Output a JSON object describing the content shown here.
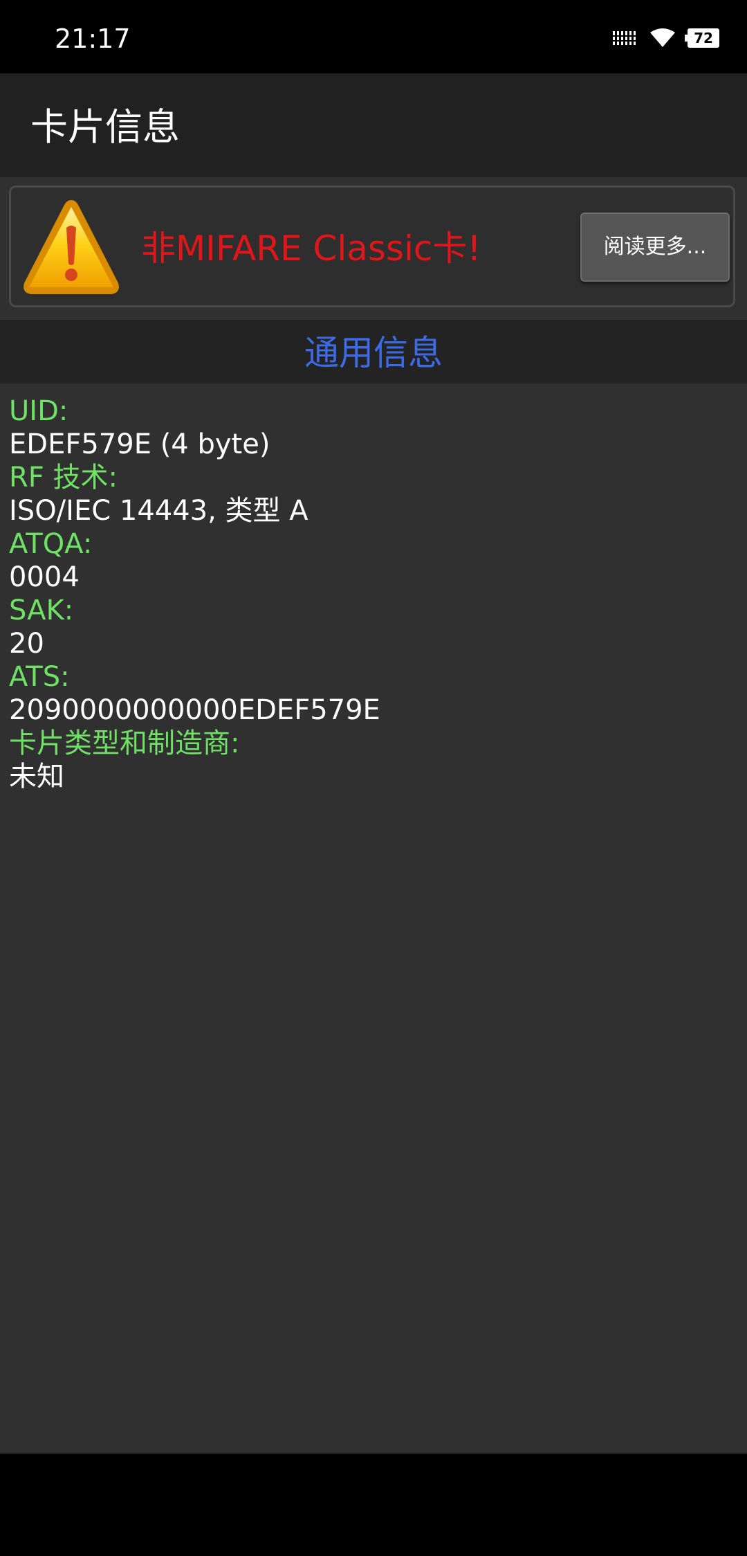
{
  "status_bar": {
    "time": "21:17",
    "battery": "72",
    "icons": [
      "signal-icon",
      "wifi-icon",
      "battery-icon"
    ]
  },
  "app_bar": {
    "title": "卡片信息"
  },
  "warning": {
    "icon": "warning-triangle-icon",
    "message": "非MIFARE Classic卡!",
    "button_label": "阅读更多..."
  },
  "section": {
    "title": "通用信息"
  },
  "info": [
    {
      "label": "UID:",
      "value": "EDEF579E (4 byte)"
    },
    {
      "label": "RF 技术:",
      "value": "ISO/IEC 14443, 类型 A"
    },
    {
      "label": "ATQA:",
      "value": "0004"
    },
    {
      "label": "SAK:",
      "value": "20"
    },
    {
      "label": "ATS:",
      "value": "2090000000000EDEF579E"
    },
    {
      "label": "卡片类型和制造商:",
      "value": "未知"
    }
  ],
  "colors": {
    "label": "#6fe265",
    "value": "#ffffff",
    "warning": "#e0161a",
    "section_title": "#3d6be6",
    "background": "#303030"
  }
}
